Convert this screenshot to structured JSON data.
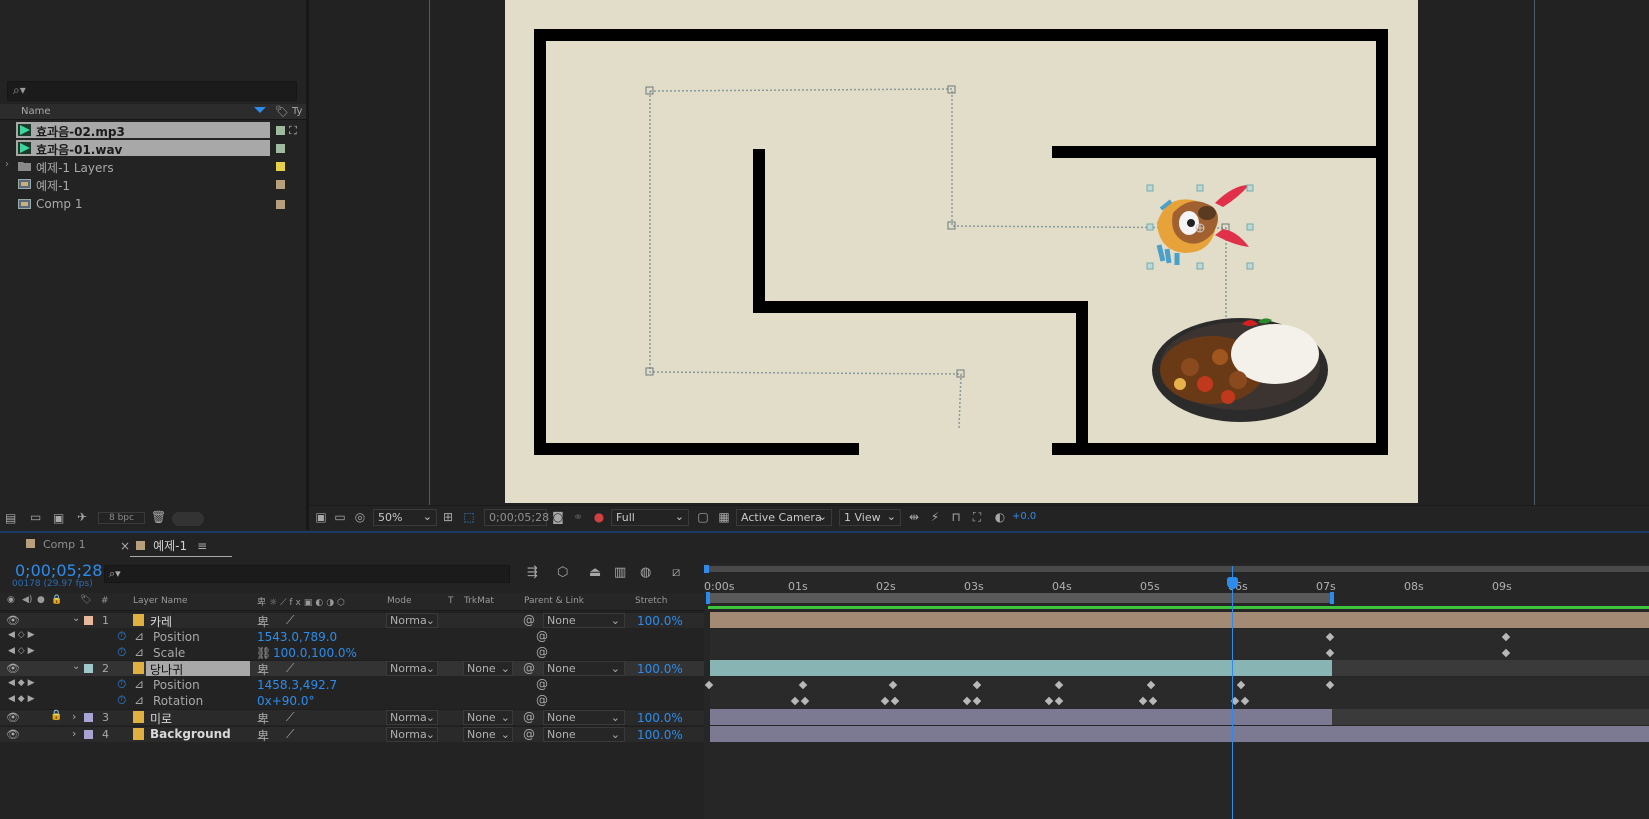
{
  "project": {
    "search_placeholder": "",
    "columns": {
      "name": "Name",
      "type": "Ty"
    },
    "items": [
      {
        "name": "효과음-02.mp3",
        "icon": "audio-icon",
        "swatch": "#9ebb9e",
        "selected": true
      },
      {
        "name": "효과음-01.wav",
        "icon": "audio-icon",
        "swatch": "#9ebb9e",
        "selected": true
      },
      {
        "name": "예제-1 Layers",
        "icon": "folder-icon",
        "swatch": "#e5d04a",
        "selected": false
      },
      {
        "name": "예제-1",
        "icon": "composition-icon",
        "swatch": "#b79f7c",
        "selected": false
      },
      {
        "name": "Comp 1",
        "icon": "composition-icon",
        "swatch": "#b79f7c",
        "selected": false
      }
    ],
    "bpc": "8 bpc"
  },
  "viewer": {
    "zoom": "50%",
    "timecode": "0;00;05;28",
    "resolution": "Full",
    "camera": "Active Camera",
    "views": "1 View",
    "exposure": "+0.0"
  },
  "timeline": {
    "tabs": [
      {
        "label": "Comp 1",
        "active": false
      },
      {
        "label": "예제-1",
        "active": true
      }
    ],
    "current_time": "0;00;05;28",
    "frame_info": "00178 (29.97 fps)",
    "columns": {
      "num": "#",
      "layer_name": "Layer Name",
      "mode": "Mode",
      "t": "T",
      "trkmat": "TrkMat",
      "parent": "Parent & Link",
      "stretch": "Stretch"
    },
    "ruler": [
      "0:00s",
      "01s",
      "02s",
      "03s",
      "04s",
      "05s",
      "06s",
      "07s",
      "08s",
      "09s"
    ],
    "layers": [
      {
        "num": "1",
        "name": "카레",
        "color": "#e8b89a",
        "mode": "Norma",
        "trkmat": "",
        "parent": "None",
        "stretch": "100.0%",
        "props": [
          {
            "name": "Position",
            "value": "1543.0,789.0"
          },
          {
            "name": "Scale",
            "value": "100.0,100.0%"
          }
        ]
      },
      {
        "num": "2",
        "name": "당나귀",
        "color": "#9fc9c9",
        "mode": "Norma",
        "trkmat": "None",
        "parent": "None",
        "stretch": "100.0%",
        "props": [
          {
            "name": "Position",
            "value": "1458.3,492.7"
          },
          {
            "name": "Rotation",
            "value": "0x+90.0°"
          }
        ]
      },
      {
        "num": "3",
        "name": "미로",
        "color": "#a8a4d6",
        "mode": "Norma",
        "trkmat": "None",
        "parent": "None",
        "stretch": "100.0%",
        "props": []
      },
      {
        "num": "4",
        "name": "Background",
        "color": "#a8a4d6",
        "mode": "Norma",
        "trkmat": "None",
        "parent": "None",
        "stretch": "100.0%",
        "props": []
      }
    ]
  },
  "colors": {
    "accent": "#2d8ceb",
    "canvas": "#e1ddc9",
    "work_area": "#5a5a5a",
    "green_bar": "#3ec43e"
  }
}
